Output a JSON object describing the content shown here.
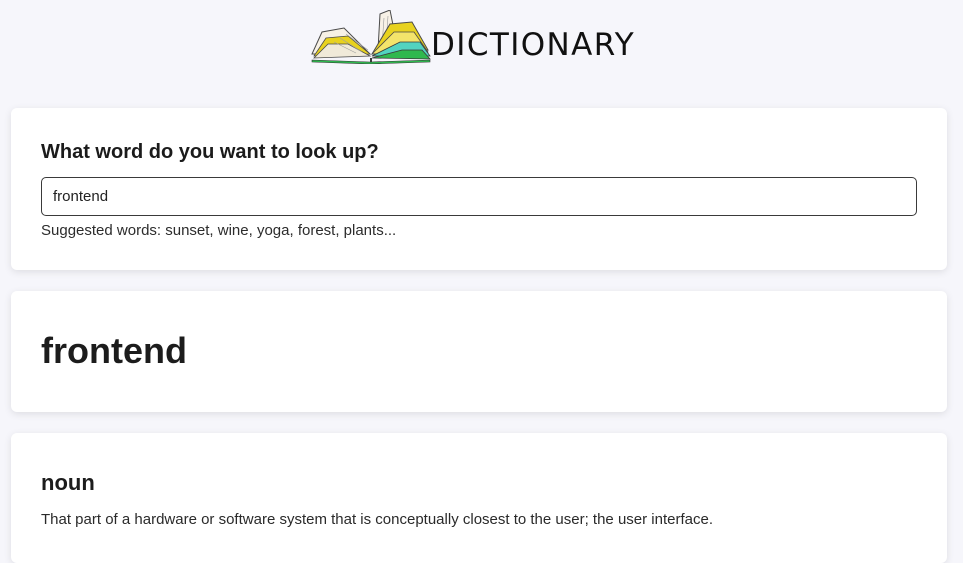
{
  "header": {
    "logo_icon": "open-book-icon",
    "title": "DICTIONARY"
  },
  "search": {
    "prompt": "What word do you want to look up?",
    "value": "frontend",
    "suggestions": "Suggested words: sunset, wine, yoga, forest, plants..."
  },
  "result": {
    "word": "frontend",
    "meanings": [
      {
        "part_of_speech": "noun",
        "definition": "That part of a hardware or software system that is conceptually closest to the user; the user interface."
      }
    ]
  },
  "colors": {
    "page_background": "#f6f6fb",
    "card_background": "#ffffff",
    "book_yellow": "#e8d21f",
    "book_green": "#2fb84e",
    "book_teal": "#52d3c0"
  }
}
